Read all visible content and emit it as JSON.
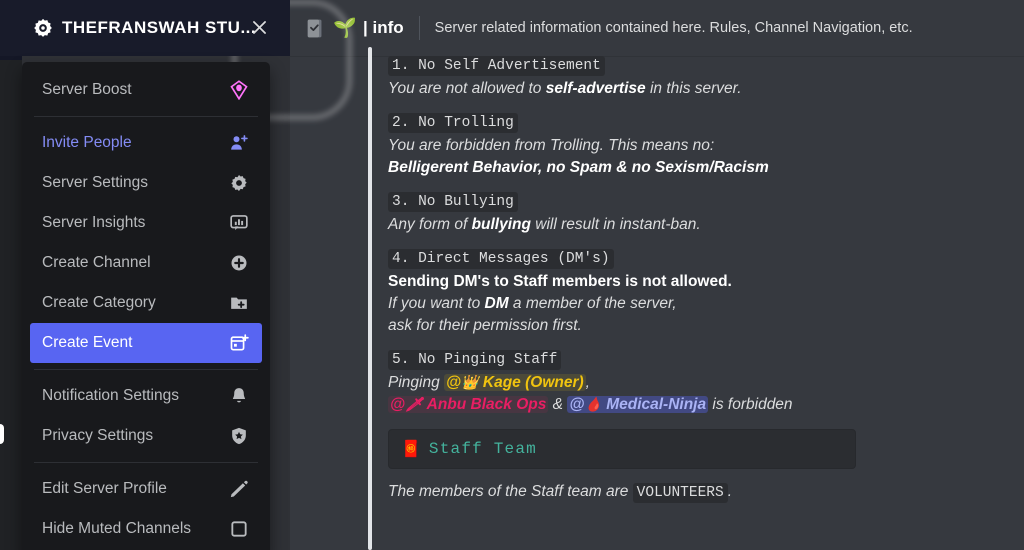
{
  "server_banner": {
    "title": "THEFRANSWAH STU...",
    "logo_icon": "server-gear-icon",
    "close_icon": "close-icon"
  },
  "context_menu": {
    "items": [
      {
        "label": "Server Boost",
        "icon": "boost-gem-icon",
        "tone": "normal",
        "selected": false,
        "sep_after": true
      },
      {
        "label": "Invite People",
        "icon": "person-add-icon",
        "tone": "blurple",
        "selected": false,
        "sep_after": false
      },
      {
        "label": "Server Settings",
        "icon": "gear-icon",
        "tone": "normal",
        "selected": false,
        "sep_after": false
      },
      {
        "label": "Server Insights",
        "icon": "insights-icon",
        "tone": "normal",
        "selected": false,
        "sep_after": false
      },
      {
        "label": "Create Channel",
        "icon": "plus-circle-icon",
        "tone": "normal",
        "selected": false,
        "sep_after": false
      },
      {
        "label": "Create Category",
        "icon": "folder-plus-icon",
        "tone": "normal",
        "selected": false,
        "sep_after": false
      },
      {
        "label": "Create Event",
        "icon": "calendar-plus-icon",
        "tone": "normal",
        "selected": true,
        "sep_after": true
      },
      {
        "label": "Notification Settings",
        "icon": "bell-icon",
        "tone": "normal",
        "selected": false,
        "sep_after": false
      },
      {
        "label": "Privacy Settings",
        "icon": "shield-star-icon",
        "tone": "normal",
        "selected": false,
        "sep_after": true
      },
      {
        "label": "Edit Server Profile",
        "icon": "pencil-icon",
        "tone": "normal",
        "selected": false,
        "sep_after": false
      },
      {
        "label": "Hide Muted Channels",
        "icon": "checkbox-icon",
        "tone": "normal",
        "selected": false,
        "sep_after": false
      }
    ]
  },
  "channel_header": {
    "rules_icon": "rules-channel-icon",
    "emoji": "🌱",
    "separator": "|",
    "name": "info",
    "topic": "Server related information contained here. Rules, Channel Navigation, etc."
  },
  "message": {
    "rules": [
      {
        "heading": "1. No Self Advertisement",
        "lines": [
          {
            "style": "italic",
            "parts": [
              {
                "t": "text",
                "v": "You are not allowed to "
              },
              {
                "t": "bold",
                "v": "self-advertise"
              },
              {
                "t": "text",
                "v": " in this server."
              }
            ]
          }
        ]
      },
      {
        "heading": "2. No Trolling",
        "lines": [
          {
            "style": "italic",
            "parts": [
              {
                "t": "text",
                "v": "You are forbidden from Trolling. This means no:"
              }
            ]
          },
          {
            "style": "italic",
            "parts": [
              {
                "t": "bold",
                "v": "Belligerent Behavior, no Spam & no Sexism/Racism"
              }
            ]
          }
        ]
      },
      {
        "heading": "3. No Bullying",
        "lines": [
          {
            "style": "italic",
            "parts": [
              {
                "t": "text",
                "v": "Any form of "
              },
              {
                "t": "bold",
                "v": "bullying"
              },
              {
                "t": "text",
                "v": " will result in instant-ban."
              }
            ]
          }
        ]
      },
      {
        "heading": "4. Direct Messages (DM's)",
        "lines": [
          {
            "style": "bold-upright",
            "parts": [
              {
                "t": "text",
                "v": "Sending DM's to Staff members is not allowed."
              }
            ]
          },
          {
            "style": "italic",
            "parts": [
              {
                "t": "text",
                "v": "If you want to "
              },
              {
                "t": "bold",
                "v": "DM"
              },
              {
                "t": "text",
                "v": " a member of the server,"
              }
            ]
          },
          {
            "style": "italic",
            "parts": [
              {
                "t": "text",
                "v": "ask for their permission first."
              }
            ]
          }
        ]
      },
      {
        "heading": "5. No Pinging Staff",
        "lines": [
          {
            "style": "italic",
            "parts": [
              {
                "t": "text",
                "v": "Pinging "
              },
              {
                "t": "mention",
                "cls": "m-kage",
                "emoji": "👑",
                "v": "@",
                "name": "Kage (Owner)"
              },
              {
                "t": "text",
                "v": ","
              }
            ]
          },
          {
            "style": "italic",
            "parts": [
              {
                "t": "mention",
                "cls": "m-anbu",
                "emoji": "🗡",
                "v": "@",
                "name": "Anbu Black Ops"
              },
              {
                "t": "text",
                "v": " & "
              },
              {
                "t": "mention",
                "cls": "m-medical",
                "emoji": "🩸",
                "v": "@",
                "name": "Medical-Ninja"
              },
              {
                "t": "text",
                "v": " is forbidden"
              }
            ]
          }
        ]
      }
    ],
    "codeblock": {
      "emoji": "🧧",
      "text": "Staff Team"
    },
    "tail": {
      "prefix": "The members of the Staff team are ",
      "code": "VOLUNTEERS",
      "suffix": "."
    }
  },
  "colors": {
    "blurple": "#5865f2",
    "boost_pink": "#ff73fa",
    "code_teal": "#44b39d",
    "kage_gold": "#f1c40f",
    "anbu_crimson": "#e91e63",
    "medical_blue": "#aab3f5"
  }
}
